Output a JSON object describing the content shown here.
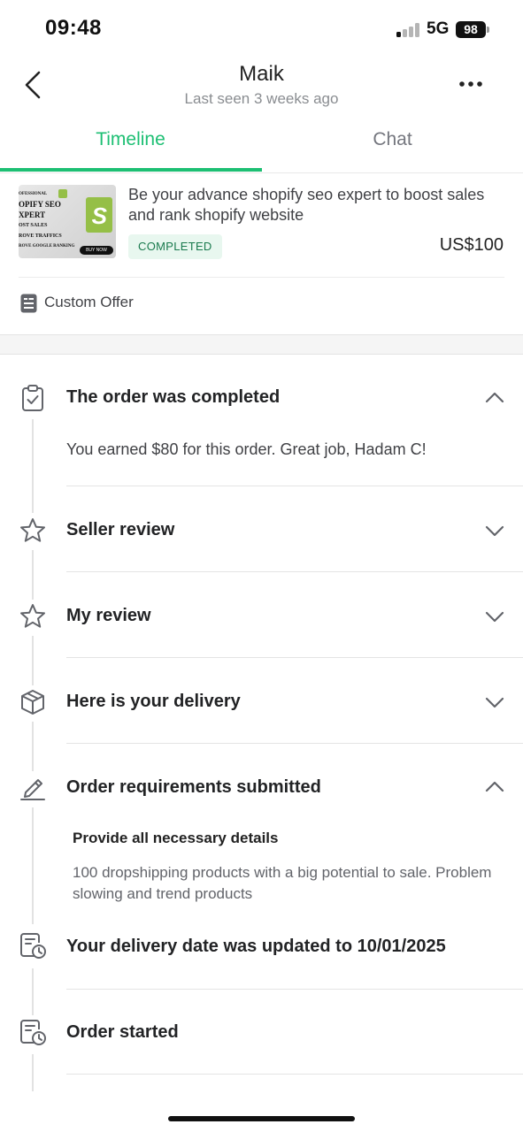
{
  "status_bar": {
    "time": "09:48",
    "network": "5G",
    "battery": "98"
  },
  "header": {
    "title": "Maik",
    "subtitle": "Last seen 3 weeks ago"
  },
  "tabs": [
    {
      "label": "Timeline",
      "active": true
    },
    {
      "label": "Chat",
      "active": false
    }
  ],
  "gig": {
    "thumbnail_text": [
      "OFESSIONAL",
      "OPIFY SEO",
      "XPERT",
      "OST SALES",
      "ROVE TRAFFICS",
      "ROVE GOOGLE RANKING"
    ],
    "thumbnail_button": "BUY NOW",
    "title": "Be your advance shopify seo expert to boost sales and rank shopify website",
    "status": "COMPLETED",
    "price": "US$100",
    "offer_label": "Custom Offer"
  },
  "timeline": {
    "completed": {
      "title": "The order was completed",
      "body": "You earned $80 for this order. Great job, Hadam C!",
      "expanded": true
    },
    "seller_review": {
      "title": "Seller review",
      "expanded": false
    },
    "my_review": {
      "title": "My review",
      "expanded": false
    },
    "delivery": {
      "title": "Here is your delivery",
      "expanded": false
    },
    "requirements": {
      "title": "Order requirements submitted",
      "expanded": true,
      "question": "Provide all necessary details",
      "answer": "100 dropshipping products with a big potential to sale. Problem slowing and trend products"
    },
    "delivery_date": {
      "title": "Your delivery date was updated to 10/01/2025"
    },
    "started": {
      "title": "Order started"
    }
  },
  "colors": {
    "accent": "#1dbf73",
    "pill_bg": "#e8f7ef",
    "pill_text": "#1a7a4e"
  }
}
